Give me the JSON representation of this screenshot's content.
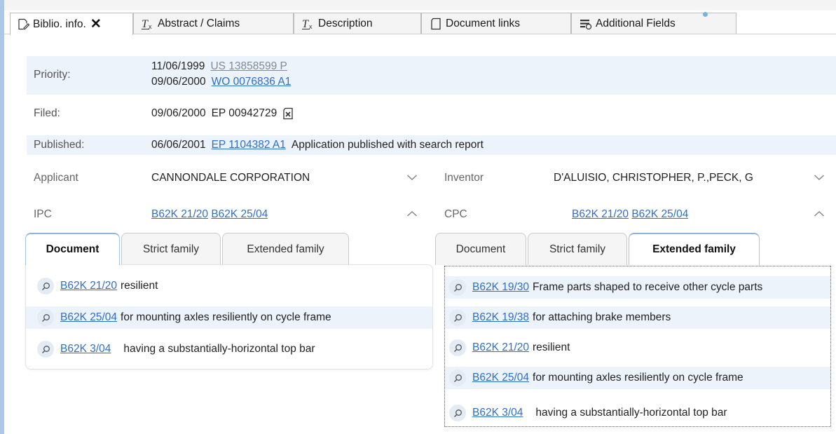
{
  "tabs": [
    {
      "label": "Biblio. info.",
      "icon": "biblio-edit-icon",
      "active": true,
      "close": "✕"
    },
    {
      "label": "Abstract / Claims",
      "icon": "clear-format-icon"
    },
    {
      "label": "Description",
      "icon": "clear-format-icon"
    },
    {
      "label": "Document links",
      "icon": "document-icon"
    },
    {
      "label": "Additional Fields",
      "icon": "fields-list-icon"
    }
  ],
  "biblio": {
    "priority": {
      "label": "Priority:",
      "entries": [
        {
          "date": "11/06/1999",
          "number": "US 13858599 P"
        },
        {
          "date": "09/06/2000",
          "number": "WO 0076836 A1"
        }
      ]
    },
    "filed": {
      "label": "Filed:",
      "date": "09/06/2000",
      "number": "EP 00942729"
    },
    "published": {
      "label": "Published:",
      "date": "06/06/2001",
      "number": "EP 1104382 A1",
      "note": "Application published with search report"
    }
  },
  "fields": {
    "applicant": {
      "label": "Applicant",
      "value": "CANNONDALE CORPORATION"
    },
    "inventor": {
      "label": "Inventor",
      "value": "D'ALUISIO, CHRISTOPHER, P.,PECK, G"
    },
    "ipc": {
      "label": "IPC",
      "codes": [
        "B62K 21/20",
        "B62K 25/04"
      ]
    },
    "cpc": {
      "label": "CPC",
      "codes": [
        "B62K 21/20",
        "B62K 25/04"
      ]
    }
  },
  "left_subtabs": [
    "Document",
    "Strict family",
    "Extended family"
  ],
  "right_subtabs": [
    "Document",
    "Strict family",
    "Extended family"
  ],
  "left_classes": [
    {
      "code": "B62K 21/20",
      "desc": "resilient"
    },
    {
      "code": "B62K 25/04",
      "desc": "for mounting axles resiliently on cycle frame"
    },
    {
      "code": "B62K 3/04",
      "desc": "having a substantially-horizontal top bar"
    }
  ],
  "right_classes": [
    {
      "code": "B62K 19/30",
      "desc": "Frame parts shaped to receive other cycle parts"
    },
    {
      "code": "B62K 19/38",
      "desc": "for attaching brake members"
    },
    {
      "code": "B62K 21/20",
      "desc": "resilient"
    },
    {
      "code": "B62K 25/04",
      "desc": "for mounting axles resiliently on cycle frame"
    },
    {
      "code": "B62K 3/04",
      "desc": "having a substantially-horizontal top bar"
    }
  ],
  "colors": {
    "link": "#2e6fc8",
    "row_shade": "#edf3fb",
    "left_bar": "#a9c8ea",
    "notification_dot": "#73b5e6"
  }
}
